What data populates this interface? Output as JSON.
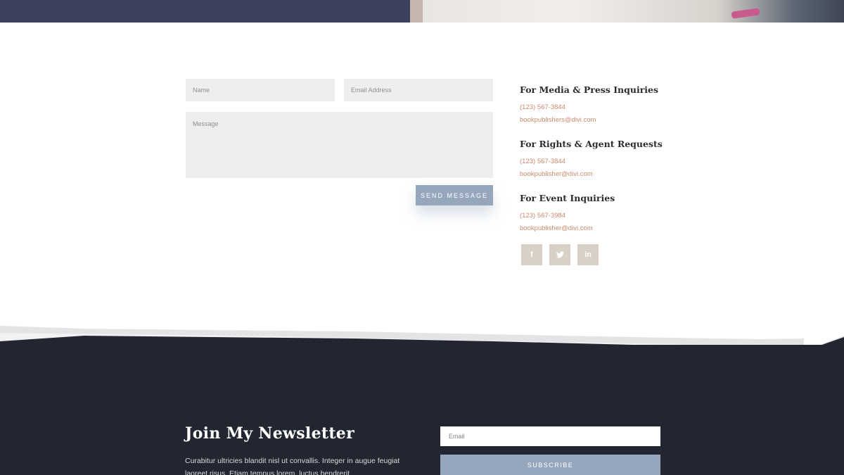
{
  "colors": {
    "hero_navy": "#3c415e",
    "accent_blue": "#96a6bd",
    "link_rust": "#c98a6e",
    "social_tan": "#d9d0c6",
    "footer_dark": "#232630"
  },
  "contact_form": {
    "name_placeholder": "Name",
    "email_placeholder": "Email Address",
    "message_placeholder": "Message",
    "send_label": "Send Message"
  },
  "contact_info": [
    {
      "title": "For Media & Press Inquiries",
      "phone": "(123) 567-3844",
      "email": "bookpublishers@divi.com"
    },
    {
      "title": "For Rights & Agent Requests",
      "phone": "(123) 567-3844",
      "email": "bookpublisher@divi.com"
    },
    {
      "title": "For Event Inquiries",
      "phone": "(123) 567-3984",
      "email": "bookpublisher@divi.com"
    }
  ],
  "social": [
    {
      "icon": "facebook-icon",
      "glyph": "f"
    },
    {
      "icon": "twitter-icon",
      "glyph": "🐦"
    },
    {
      "icon": "linkedin-icon",
      "glyph": "in"
    }
  ],
  "newsletter": {
    "title": "Join My Newsletter",
    "text": "Curabitur ultricies blandit nisl ut convallis. Integer in augue feugiat laoreet risus. Etiam tempus lorem, luctus hendrerit",
    "email_placeholder": "Email",
    "subscribe_label": "Subscribe"
  }
}
